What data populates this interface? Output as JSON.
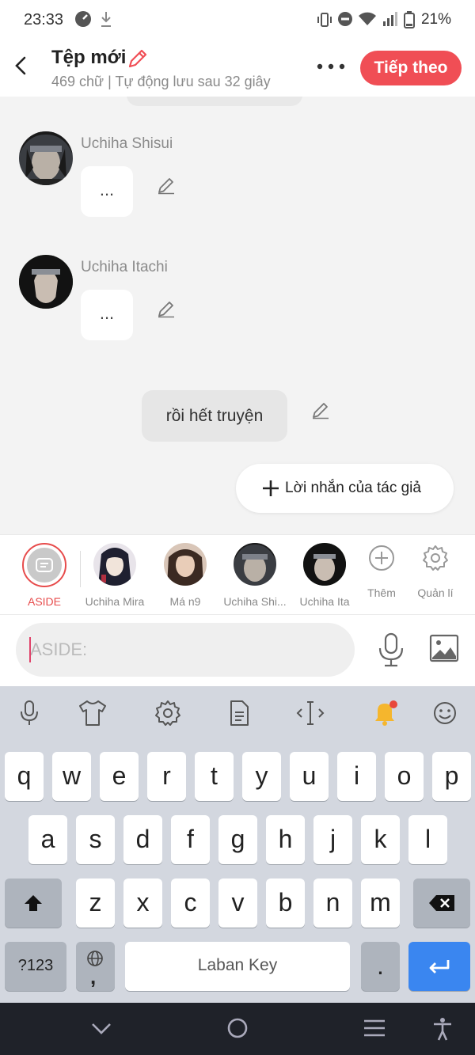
{
  "status_bar": {
    "time": "23:33",
    "battery": "21%"
  },
  "header": {
    "title": "Tệp mới",
    "subtitle": "469 chữ | Tự động lưu sau 32 giây",
    "next_label": "Tiếp theo"
  },
  "chat": {
    "messages": [
      {
        "speaker": "Uchiha Shisui",
        "text": "..."
      },
      {
        "speaker": "Uchiha Itachi",
        "text": "..."
      }
    ],
    "narration": "rồi hết truyện",
    "author_note_label": "Lời nhắn của tác giả"
  },
  "characters": {
    "aside_label": "ASIDE",
    "items": [
      {
        "label": "Uchiha Mira"
      },
      {
        "label": "Má n9"
      },
      {
        "label": "Uchiha Shi..."
      },
      {
        "label": "Uchiha Ita"
      }
    ],
    "add_label": "Thêm",
    "manage_label": "Quản lí"
  },
  "input": {
    "placeholder": "ASIDE:"
  },
  "keyboard": {
    "row1": [
      "q",
      "w",
      "e",
      "r",
      "t",
      "y",
      "u",
      "i",
      "o",
      "p"
    ],
    "row2": [
      "a",
      "s",
      "d",
      "f",
      "g",
      "h",
      "j",
      "k",
      "l"
    ],
    "row3": [
      "z",
      "x",
      "c",
      "v",
      "b",
      "n",
      "m"
    ],
    "symbols_label": "?123",
    "comma_label": ",",
    "space_label": "Laban Key",
    "period_label": "."
  },
  "colors": {
    "accent": "#f04e55",
    "aside_ring": "#e74c4c",
    "enter_key": "#3a86f0"
  }
}
